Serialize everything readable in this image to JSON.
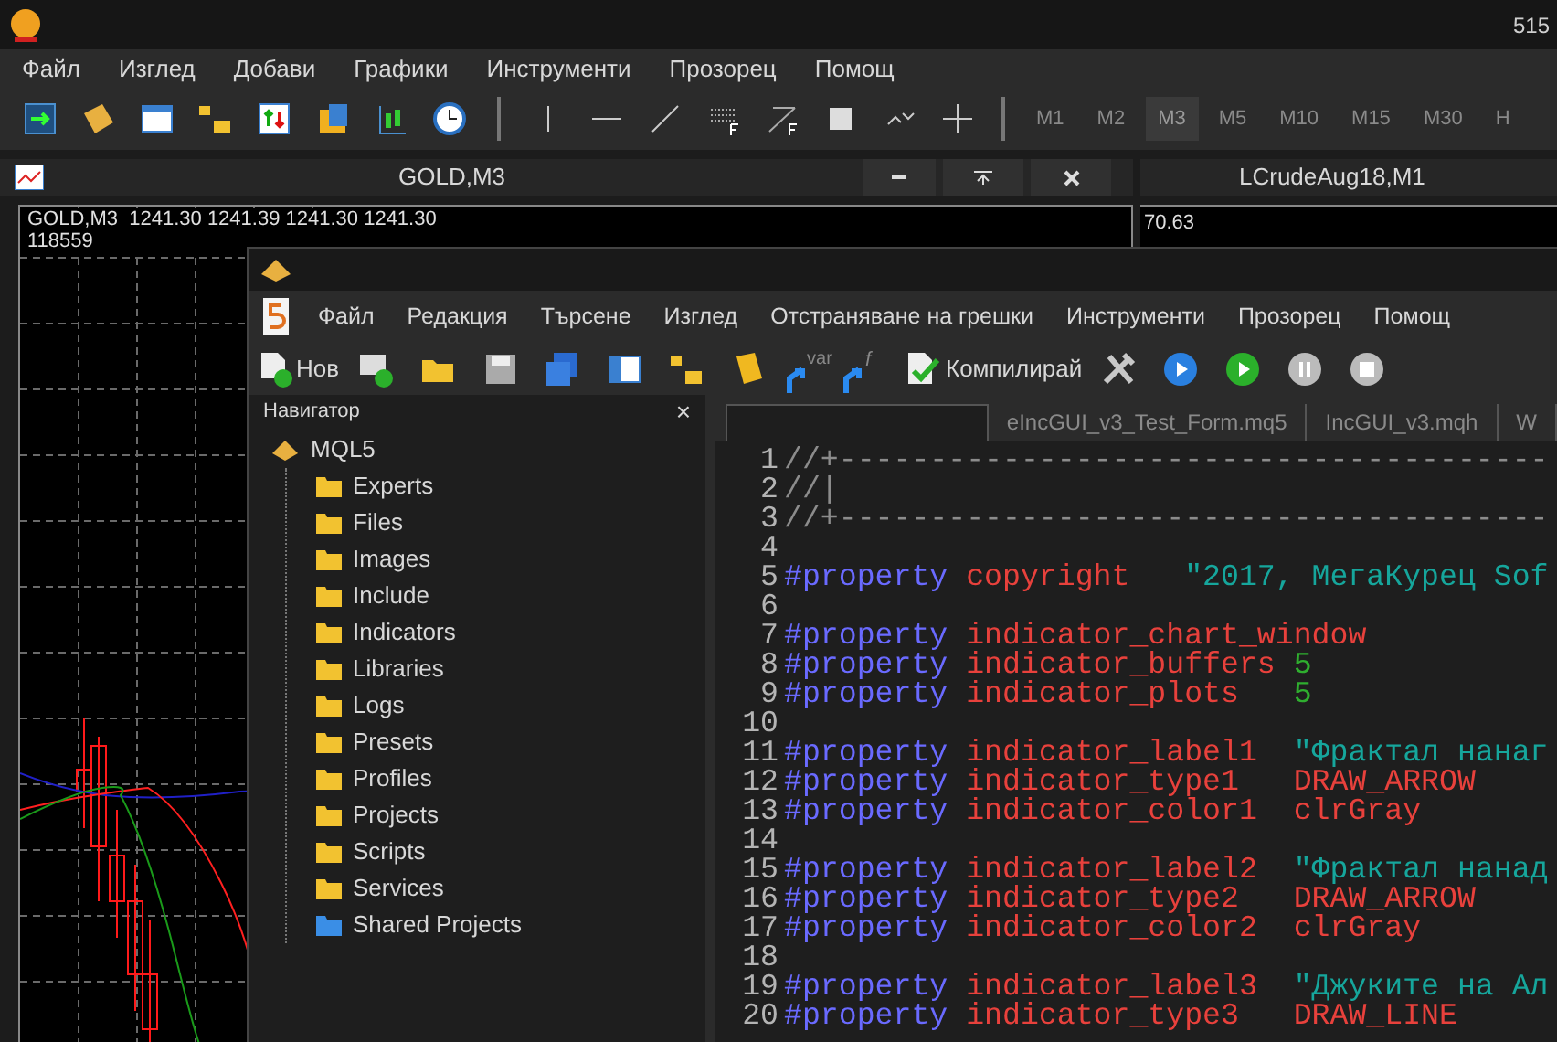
{
  "terminal": {
    "title": "515",
    "menu": [
      "Файл",
      "Изглед",
      "Добави",
      "Графики",
      "Инструменти",
      "Прозорец",
      "Помощ"
    ],
    "timeframes": [
      {
        "label": "M1",
        "selected": false
      },
      {
        "label": "M2",
        "selected": false
      },
      {
        "label": "M3",
        "selected": true
      },
      {
        "label": "M5",
        "selected": false
      },
      {
        "label": "M10",
        "selected": false
      },
      {
        "label": "M15",
        "selected": false
      },
      {
        "label": "M30",
        "selected": false
      },
      {
        "label": "H",
        "selected": false
      }
    ],
    "charts": [
      {
        "title": "GOLD,M3",
        "info": "GOLD,M3  1241.30 1241.39 1241.30 1241.30",
        "volume": "118559"
      },
      {
        "title": "LCrudeAug18,M1",
        "price": "70.63"
      }
    ]
  },
  "editor": {
    "menu": [
      "Файл",
      "Редакция",
      "Търсене",
      "Изглед",
      "Отстраняване на грешки",
      "Инструменти",
      "Прозорец",
      "Помощ"
    ],
    "new_label": "Нов",
    "var_label": "var",
    "func_label": "f",
    "compile_label": "Компилирай",
    "navigator": {
      "title": "Навигатор",
      "close": "×",
      "root": {
        "label": "MQL5",
        "children": [
          {
            "label": "Experts",
            "kind": "folder"
          },
          {
            "label": "Files",
            "kind": "folder"
          },
          {
            "label": "Images",
            "kind": "folder"
          },
          {
            "label": "Include",
            "kind": "folder"
          },
          {
            "label": "Indicators",
            "kind": "folder"
          },
          {
            "label": "Libraries",
            "kind": "folder"
          },
          {
            "label": "Logs",
            "kind": "folder"
          },
          {
            "label": "Presets",
            "kind": "folder"
          },
          {
            "label": "Profiles",
            "kind": "folder"
          },
          {
            "label": "Projects",
            "kind": "folder"
          },
          {
            "label": "Scripts",
            "kind": "folder"
          },
          {
            "label": "Services",
            "kind": "folder"
          },
          {
            "label": "Shared Projects",
            "kind": "shared"
          }
        ]
      }
    },
    "tabs": [
      {
        "label": "eIncGUI_v3_Test_Form.mq5",
        "selected": false
      },
      {
        "label": "IncGUI_v3.mqh",
        "selected": false
      },
      {
        "label": "W",
        "selected": false
      }
    ],
    "code": [
      {
        "n": "1",
        "tokens": [
          {
            "kind": "comment",
            "text": "//+---------------------------------------"
          }
        ]
      },
      {
        "n": "2",
        "tokens": [
          {
            "kind": "comment",
            "text": "//|"
          }
        ]
      },
      {
        "n": "3",
        "tokens": [
          {
            "kind": "comment",
            "text": "//+---------------------------------------"
          }
        ]
      },
      {
        "n": "4"
      },
      {
        "n": "5",
        "tokens": [
          {
            "kind": "directive",
            "text": "#property"
          },
          {
            "kind": "keyword",
            "text": " copyright   "
          },
          {
            "kind": "string",
            "text": "\"2017, МегаКурец Sof"
          }
        ]
      },
      {
        "n": "6"
      },
      {
        "n": "7",
        "tokens": [
          {
            "kind": "directive",
            "text": "#property"
          },
          {
            "kind": "keyword",
            "text": " indicator_chart_window"
          }
        ]
      },
      {
        "n": "8",
        "tokens": [
          {
            "kind": "directive",
            "text": "#property"
          },
          {
            "kind": "keyword",
            "text": " indicator_buffers "
          },
          {
            "kind": "number",
            "text": "5"
          }
        ]
      },
      {
        "n": "9",
        "tokens": [
          {
            "kind": "directive",
            "text": "#property"
          },
          {
            "kind": "keyword",
            "text": " indicator_plots   "
          },
          {
            "kind": "number",
            "text": "5"
          }
        ]
      },
      {
        "n": "10"
      },
      {
        "n": "11",
        "tokens": [
          {
            "kind": "directive",
            "text": "#property"
          },
          {
            "kind": "keyword",
            "text": " indicator_label1  "
          },
          {
            "kind": "string",
            "text": "\"Фрактал нанаг"
          }
        ]
      },
      {
        "n": "12",
        "tokens": [
          {
            "kind": "directive",
            "text": "#property"
          },
          {
            "kind": "keyword",
            "text": " indicator_type1   DRAW_ARROW"
          }
        ]
      },
      {
        "n": "13",
        "tokens": [
          {
            "kind": "directive",
            "text": "#property"
          },
          {
            "kind": "keyword",
            "text": " indicator_color1  clrGray"
          }
        ]
      },
      {
        "n": "14"
      },
      {
        "n": "15",
        "tokens": [
          {
            "kind": "directive",
            "text": "#property"
          },
          {
            "kind": "keyword",
            "text": " indicator_label2  "
          },
          {
            "kind": "string",
            "text": "\"Фрактал нанад"
          }
        ]
      },
      {
        "n": "16",
        "tokens": [
          {
            "kind": "directive",
            "text": "#property"
          },
          {
            "kind": "keyword",
            "text": " indicator_type2   DRAW_ARROW"
          }
        ]
      },
      {
        "n": "17",
        "tokens": [
          {
            "kind": "directive",
            "text": "#property"
          },
          {
            "kind": "keyword",
            "text": " indicator_color2  clrGray"
          }
        ]
      },
      {
        "n": "18"
      },
      {
        "n": "19",
        "tokens": [
          {
            "kind": "directive",
            "text": "#property"
          },
          {
            "kind": "keyword",
            "text": " indicator_label3  "
          },
          {
            "kind": "string",
            "text": "\"Джуките на Ал"
          }
        ]
      },
      {
        "n": "20",
        "tokens": [
          {
            "kind": "directive",
            "text": "#property"
          },
          {
            "kind": "keyword",
            "text": " indicator_type3   DRAW_LINE"
          }
        ]
      }
    ]
  }
}
